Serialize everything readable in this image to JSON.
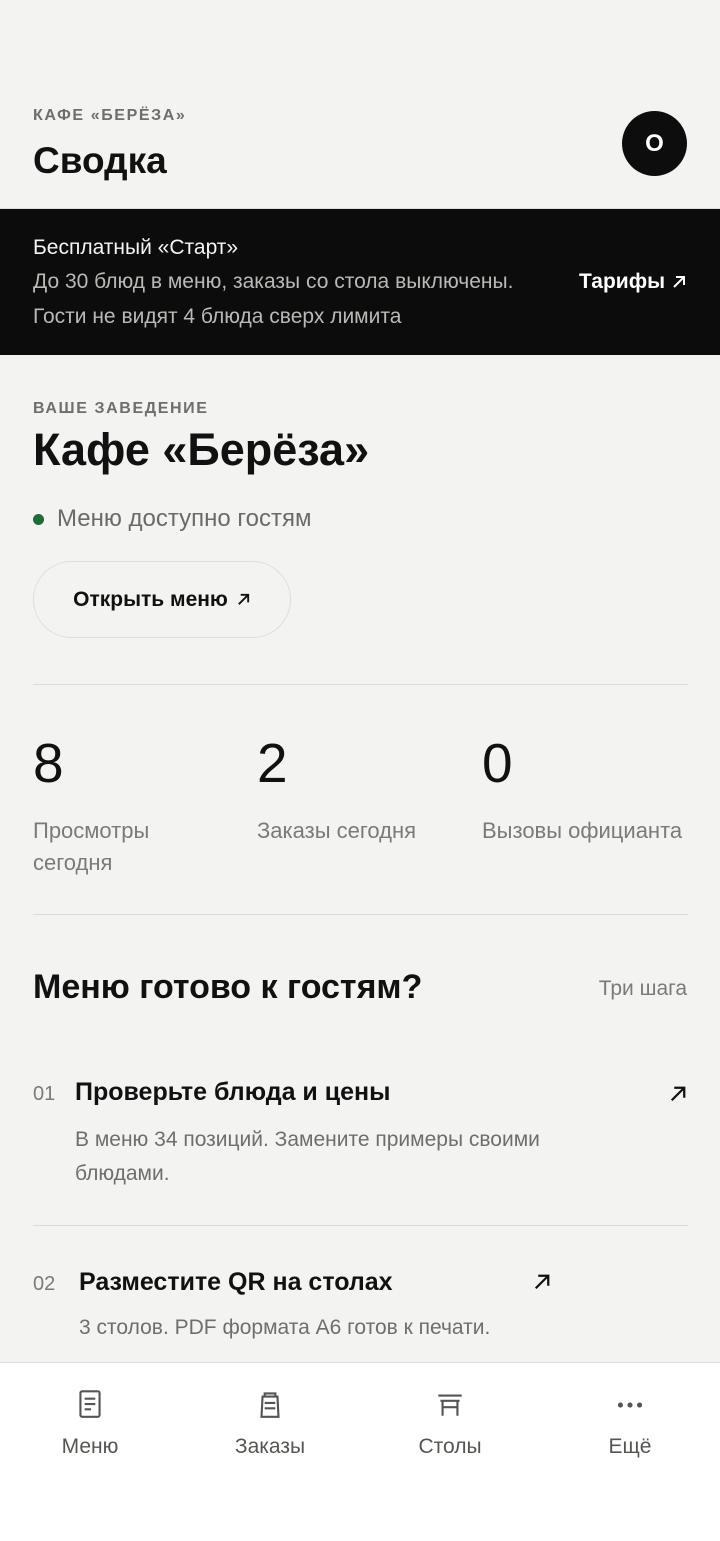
{
  "header": {
    "eyebrow": "КАФЕ «БЕРЁЗА»",
    "title": "Сводка",
    "avatar_letter": "О"
  },
  "banner": {
    "plan": "Бесплатный «Старт»",
    "line1": "До 30 блюд в меню, заказы со стола выключены.",
    "line2": "Гости не видят 4 блюда сверх лимита",
    "tariffs_label": "Тарифы"
  },
  "venue": {
    "eyebrow": "ВАШЕ ЗАВЕДЕНИЕ",
    "name": "Кафе «Берёза»",
    "status": "Меню доступно гостям",
    "open_menu_label": "Открыть меню"
  },
  "stats": [
    {
      "value": "8",
      "label_line1": "Просмотры",
      "label_line2": "сегодня"
    },
    {
      "value": "2",
      "label_line1": "Заказы сегодня",
      "label_line2": ""
    },
    {
      "value": "0",
      "label_line1": "Вызовы официанта",
      "label_line2": ""
    }
  ],
  "steps": {
    "title": "Меню готово к гостям?",
    "count": "Три шага",
    "items": [
      {
        "index": "01",
        "name": "Проверьте блюда и цены",
        "desc_line1": "В меню 34 позиций. Замените примеры своими",
        "desc_line2": "блюдами."
      },
      {
        "index": "02",
        "name": "Разместите QR на столах",
        "desc_line1": "3 столов. PDF формата A6 готов к печати.",
        "desc_line2": ""
      }
    ]
  },
  "tabbar": {
    "items": [
      {
        "label": "Меню",
        "icon": "menu-document-icon"
      },
      {
        "label": "Заказы",
        "icon": "orders-bag-icon"
      },
      {
        "label": "Столы",
        "icon": "table-icon"
      },
      {
        "label": "Ещё",
        "icon": "more-dots-icon"
      }
    ]
  }
}
